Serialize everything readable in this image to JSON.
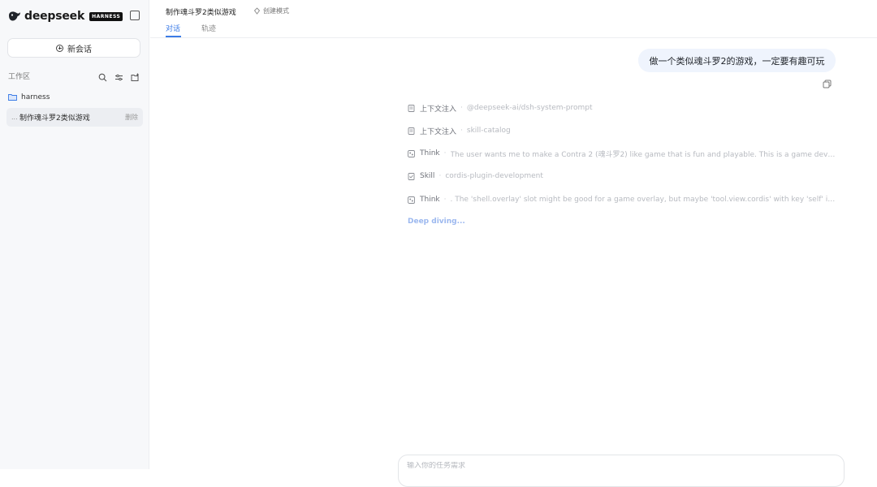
{
  "sidebar": {
    "brand_name": "deepseek",
    "brand_badge": "HARNESS",
    "new_chat_label": "新会话",
    "workspace_title": "工作区",
    "folder_name": "harness",
    "sessions": [
      {
        "dots": "...",
        "name": "制作魂斗罗2类似游戏",
        "delete_label": "删除"
      }
    ]
  },
  "header": {
    "conversation_title": "制作魂斗罗2类似游戏",
    "mode_label": "创建模式",
    "tabs": [
      {
        "label": "对话",
        "active": true
      },
      {
        "label": "轨迹",
        "active": false
      }
    ]
  },
  "chat": {
    "user_message": "做一个类似魂斗罗2的游戏，一定要有趣可玩",
    "steps": [
      {
        "icon": "document-icon",
        "label": "上下文注入",
        "detail": "@deepseek-ai/dsh-system-prompt"
      },
      {
        "icon": "document-icon",
        "label": "上下文注入",
        "detail": "skill-catalog"
      },
      {
        "icon": "brain-icon",
        "label": "Think",
        "detail": "The user wants me to make a Contra 2 (魂斗罗2) like game that is fun and playable. This is a game develop..."
      },
      {
        "icon": "skill-icon",
        "label": "Skill",
        "detail": "cordis-plugin-development"
      },
      {
        "icon": "brain-icon",
        "label": "Think",
        "detail": ". The 'shell.overlay' slot might be good for a game overlay, but maybe 'tool.view.cordis' with key 'self' is better"
      }
    ],
    "status_text": "Deep diving...",
    "composer_placeholder": "输入你的任务需求"
  },
  "colors": {
    "accent": "#3b7be6",
    "bubble_bg": "#eff4fd",
    "sidebar_bg": "#f7f8fa"
  }
}
